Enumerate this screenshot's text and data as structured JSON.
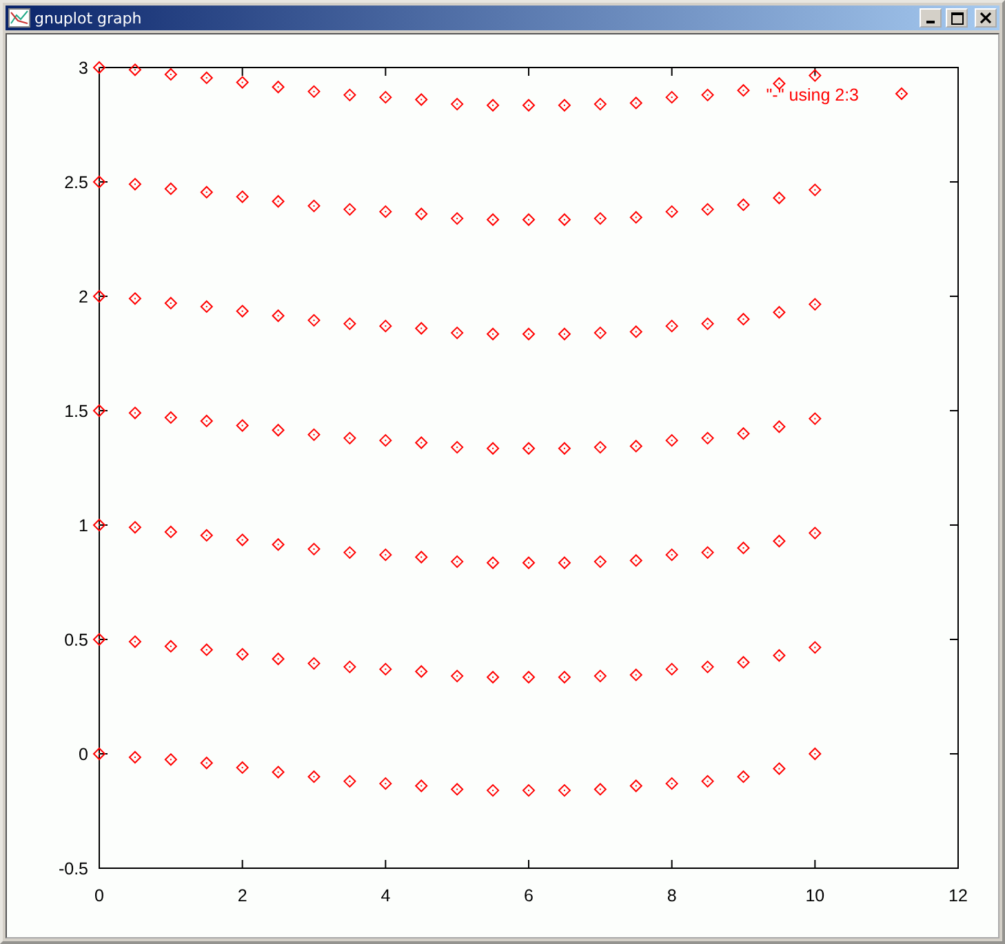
{
  "window": {
    "title": "gnuplot graph"
  },
  "chart": {
    "chart_data": {
      "type": "scatter",
      "xlim": [
        0,
        12
      ],
      "ylim": [
        -0.5,
        3
      ],
      "xticks": [
        0,
        2,
        4,
        6,
        8,
        10,
        12
      ],
      "yticks": [
        -0.5,
        0,
        0.5,
        1,
        1.5,
        2,
        2.5,
        3
      ],
      "x": [
        0,
        0.5,
        1,
        1.5,
        2,
        2.5,
        3,
        3.5,
        4,
        4.5,
        5,
        5.5,
        6,
        6.5,
        7,
        7.5,
        8,
        8.5,
        9,
        9.5,
        10,
        0,
        0.5,
        1,
        1.5,
        2,
        2.5,
        3,
        3.5,
        4,
        4.5,
        5,
        5.5,
        6,
        6.5,
        7,
        7.5,
        8,
        8.5,
        9,
        9.5,
        10,
        0,
        0.5,
        1,
        1.5,
        2,
        2.5,
        3,
        3.5,
        4,
        4.5,
        5,
        5.5,
        6,
        6.5,
        7,
        7.5,
        8,
        8.5,
        9,
        9.5,
        10,
        0,
        0.5,
        1,
        1.5,
        2,
        2.5,
        3,
        3.5,
        4,
        4.5,
        5,
        5.5,
        6,
        6.5,
        7,
        7.5,
        8,
        8.5,
        9,
        9.5,
        10,
        0,
        0.5,
        1,
        1.5,
        2,
        2.5,
        3,
        3.5,
        4,
        4.5,
        5,
        5.5,
        6,
        6.5,
        7,
        7.5,
        8,
        8.5,
        9,
        9.5,
        10,
        0,
        0.5,
        1,
        1.5,
        2,
        2.5,
        3,
        3.5,
        4,
        4.5,
        5,
        5.5,
        6,
        6.5,
        7,
        7.5,
        8,
        8.5,
        9,
        9.5,
        10,
        0,
        0.5,
        1,
        1.5,
        2,
        2.5,
        3,
        3.5,
        4,
        4.5,
        5,
        5.5,
        6,
        6.5,
        7,
        7.5,
        8,
        8.5,
        9,
        9.5,
        10
      ],
      "series": [
        {
          "name": "\"-\" using 2:3",
          "color": "#ff0000",
          "values": [
            0,
            -0.015,
            -0.025,
            -0.04,
            -0.06,
            -0.08,
            -0.1,
            -0.12,
            -0.13,
            -0.14,
            -0.155,
            -0.16,
            -0.16,
            -0.16,
            -0.155,
            -0.14,
            -0.13,
            -0.12,
            -0.1,
            -0.065,
            0,
            0.5,
            0.49,
            0.47,
            0.455,
            0.435,
            0.415,
            0.395,
            0.38,
            0.37,
            0.36,
            0.34,
            0.335,
            0.335,
            0.335,
            0.34,
            0.345,
            0.37,
            0.38,
            0.4,
            0.43,
            0.465,
            1,
            0.99,
            0.97,
            0.955,
            0.935,
            0.915,
            0.895,
            0.88,
            0.87,
            0.86,
            0.84,
            0.835,
            0.835,
            0.835,
            0.84,
            0.845,
            0.87,
            0.88,
            0.9,
            0.93,
            0.965,
            1.5,
            1.49,
            1.47,
            1.455,
            1.435,
            1.415,
            1.395,
            1.38,
            1.37,
            1.36,
            1.34,
            1.335,
            1.335,
            1.335,
            1.34,
            1.345,
            1.37,
            1.38,
            1.4,
            1.43,
            1.465,
            2,
            1.99,
            1.97,
            1.955,
            1.935,
            1.915,
            1.895,
            1.88,
            1.87,
            1.86,
            1.84,
            1.835,
            1.835,
            1.835,
            1.84,
            1.845,
            1.87,
            1.88,
            1.9,
            1.93,
            1.965,
            2.5,
            2.49,
            2.47,
            2.455,
            2.435,
            2.415,
            2.395,
            2.38,
            2.37,
            2.36,
            2.34,
            2.335,
            2.335,
            2.335,
            2.34,
            2.345,
            2.37,
            2.38,
            2.4,
            2.43,
            2.465,
            3,
            2.99,
            2.97,
            2.955,
            2.935,
            2.915,
            2.895,
            2.88,
            2.87,
            2.86,
            2.84,
            2.835,
            2.835,
            2.835,
            2.84,
            2.845,
            2.87,
            2.88,
            2.9,
            2.93,
            2.965
          ]
        }
      ]
    }
  }
}
